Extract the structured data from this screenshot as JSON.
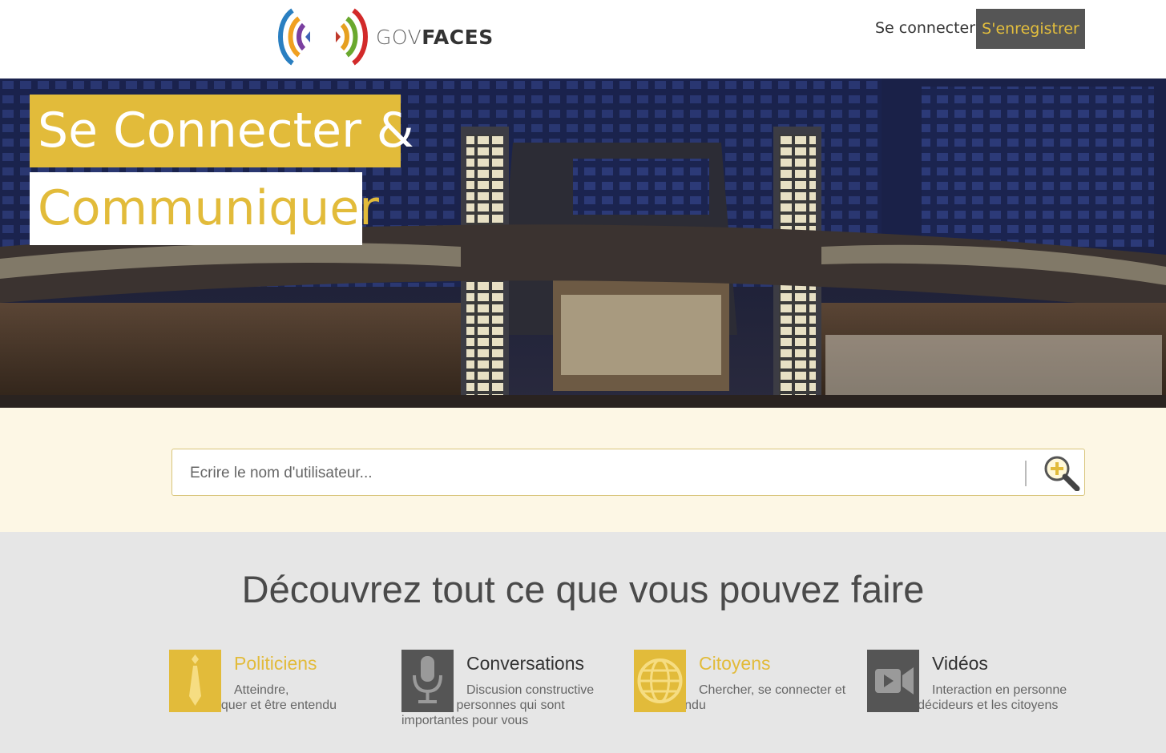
{
  "header": {
    "logo_gov": "GOV",
    "logo_faces": "FACES",
    "login_label": "Se connecter",
    "register_label": "S'enregistrer"
  },
  "hero": {
    "headline_line1": "Se Connecter &",
    "headline_line2": "Communiquer"
  },
  "search": {
    "placeholder": "Ecrire le nom d'utilisateur...",
    "value": ""
  },
  "features": {
    "title": "Découvrez tout ce que vous pouvez faire",
    "items": [
      {
        "title": "Politiciens",
        "desc": "Atteindre, communiquer et être entendu",
        "icon": "tie-icon",
        "accent": "gold"
      },
      {
        "title": "Conversations",
        "desc": "Discusion constructive avec des personnes qui sont importantes pour vous",
        "icon": "microphone-icon",
        "accent": "dark"
      },
      {
        "title": "Citoyens",
        "desc": "Chercher, se connecter et être entendu",
        "icon": "globe-icon",
        "accent": "gold"
      },
      {
        "title": "Vidéos",
        "desc": "Interaction en personne avec les décideurs et les citoyens",
        "icon": "video-camera-icon",
        "accent": "dark"
      }
    ]
  },
  "colors": {
    "accent_gold": "#e2bb3a",
    "icon_gray": "#555555",
    "search_band_bg": "#fdf7e5",
    "features_bg": "#e6e6e6"
  }
}
